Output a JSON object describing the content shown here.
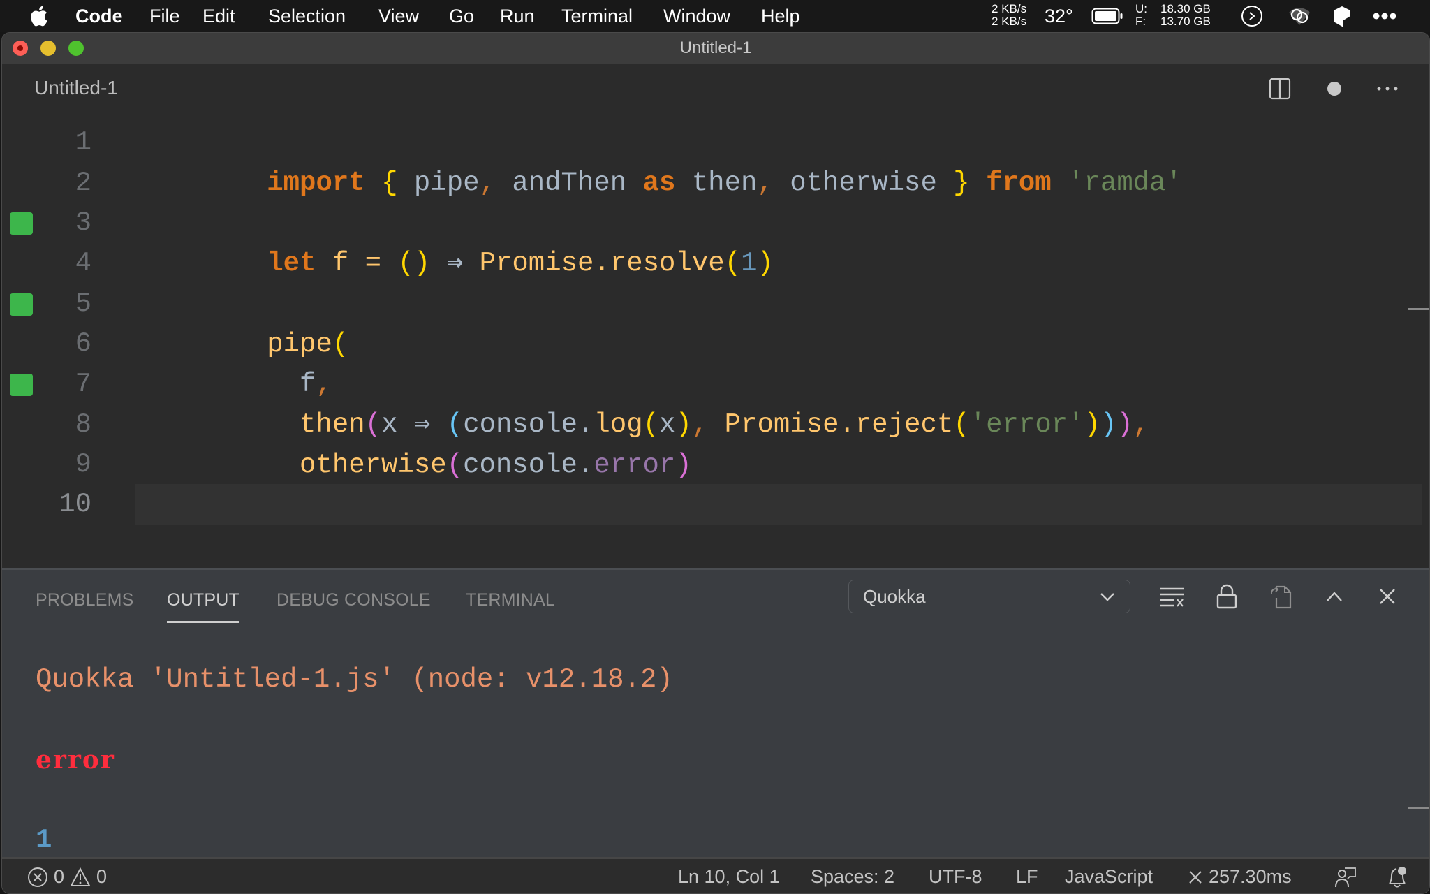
{
  "menubar": {
    "app_name": "Code",
    "items": [
      "File",
      "Edit",
      "Selection",
      "View",
      "Go",
      "Run",
      "Terminal",
      "Window",
      "Help"
    ],
    "tray": {
      "net_up": "2 KB/s",
      "net_down": "2 KB/s",
      "temperature": "32°",
      "disk_used_label": "U:",
      "disk_used": "18.30 GB",
      "disk_free_label": "F:",
      "disk_free": "13.70 GB"
    }
  },
  "window": {
    "title": "Untitled-1"
  },
  "tabbar": {
    "tab_label": "Untitled-1",
    "actions": [
      "split-editor",
      "unsaved-indicator",
      "more-actions"
    ]
  },
  "editor": {
    "current_line": 10,
    "coverage_marked_lines": [
      3,
      5,
      7
    ],
    "lines": [
      {
        "n": "1"
      },
      {
        "n": "2"
      },
      {
        "n": "3"
      },
      {
        "n": "4"
      },
      {
        "n": "5"
      },
      {
        "n": "6"
      },
      {
        "n": "7"
      },
      {
        "n": "8"
      },
      {
        "n": "9"
      },
      {
        "n": "10"
      }
    ],
    "code": {
      "l1": [
        "import",
        " ",
        "{",
        " pipe",
        ",",
        " andThen ",
        "as",
        " then",
        ",",
        " otherwise ",
        "}",
        " ",
        "from",
        " ",
        "'ramda'"
      ],
      "l3": [
        "let",
        " f = ",
        "(",
        ")",
        " ⇒ ",
        "Promise.resolve",
        "(",
        "1",
        ")"
      ],
      "l5": [
        "pipe",
        "("
      ],
      "l6": [
        "  f",
        ","
      ],
      "l7": [
        "  then",
        "(",
        "x ⇒ ",
        "(",
        "console.",
        "log",
        "(",
        "x",
        ")",
        ",",
        " ",
        "Promise.reject",
        "(",
        "'error'",
        ")",
        ")",
        ")",
        ","
      ],
      "l8": [
        "  otherwise",
        "(",
        "console.",
        "error",
        ")"
      ],
      "l9": [
        ")",
        "(",
        ")"
      ]
    }
  },
  "panel": {
    "tabs": [
      {
        "label": "PROBLEMS",
        "active": false
      },
      {
        "label": "OUTPUT",
        "active": true
      },
      {
        "label": "DEBUG CONSOLE",
        "active": false
      },
      {
        "label": "TERMINAL",
        "active": false
      }
    ],
    "channel": "Quokka",
    "output": [
      "Quokka 'Untitled-1.js' (node: v12.18.2)",
      "error",
      "1"
    ]
  },
  "statusbar": {
    "errors": "0",
    "warnings": "0",
    "position": "Ln 10, Col 1",
    "indent": "Spaces: 2",
    "encoding": "UTF-8",
    "eol": "LF",
    "language": "JavaScript",
    "quokka_time": "257.30ms"
  },
  "colors": {
    "coverage_mark": "#3db64b",
    "keyword": "#e0771c",
    "function": "#ffc66d",
    "string": "#6a8759",
    "number": "#6897bb",
    "error_output": "#ff2d3d",
    "header_output": "#e8916a"
  }
}
